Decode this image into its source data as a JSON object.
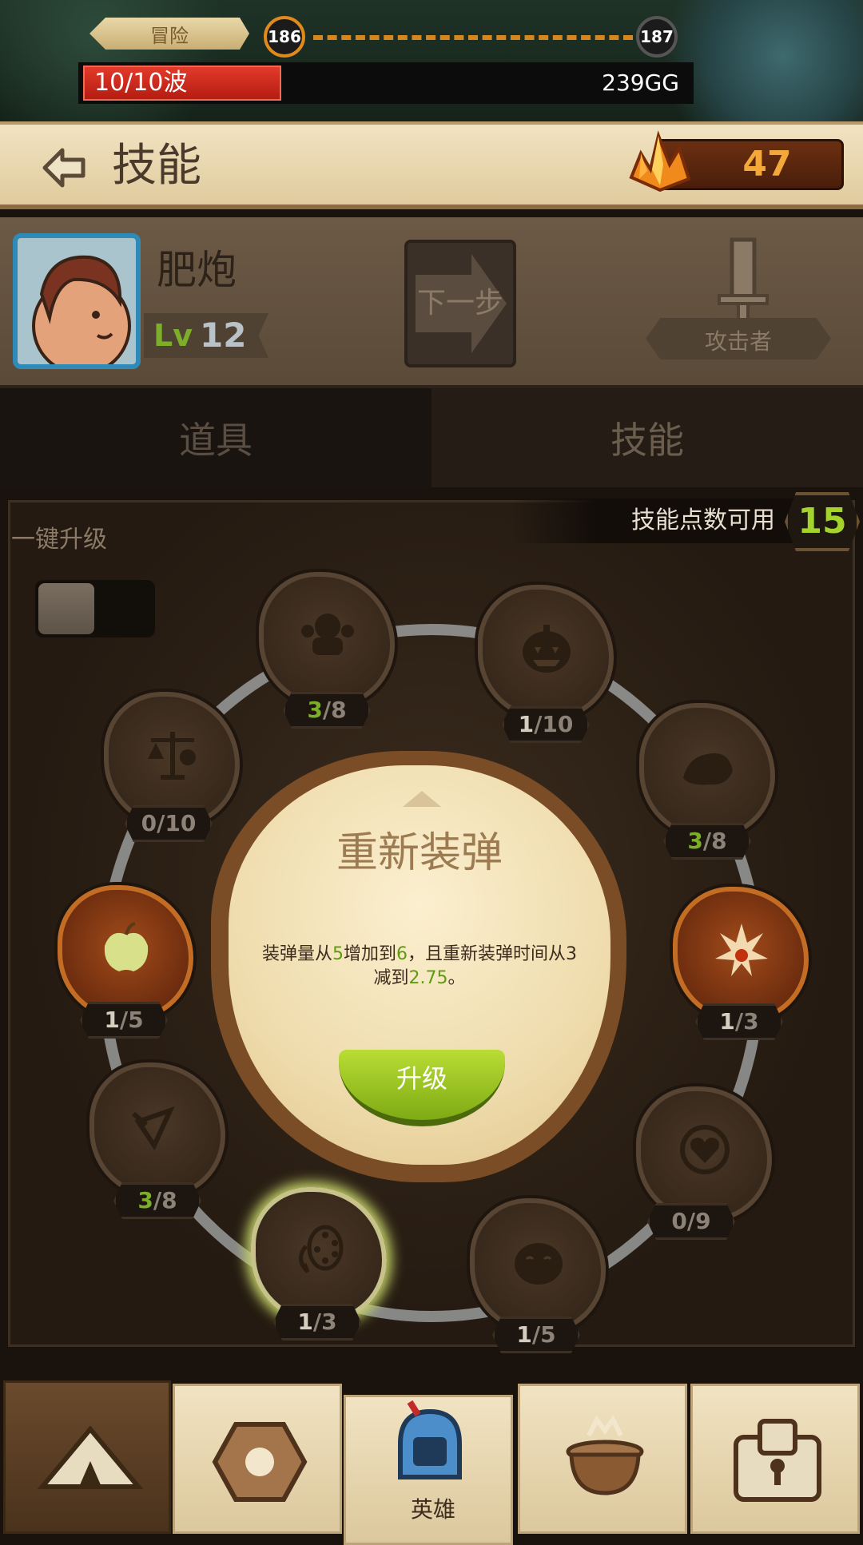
{
  "header": {
    "mode_label": "冒险",
    "current_wave_node": "186",
    "next_wave_node": "187",
    "wave_progress": "10/10波",
    "gold": "239GG"
  },
  "titlebar": {
    "back_icon": "back-arrow-icon",
    "title": "技能",
    "gem_icon": "crystal-icon",
    "gem_count": "47"
  },
  "hero": {
    "name": "肥炮",
    "level_prefix": "Lv",
    "level": "12",
    "next_label": "下一步",
    "role_icon": "sword-icon",
    "role": "攻击者"
  },
  "tabs": [
    {
      "label": "道具",
      "active": false
    },
    {
      "label": "技能",
      "active": true
    }
  ],
  "skills_panel": {
    "points_label": "技能点数可用",
    "points_value": "15",
    "one_click_label": "一键升级",
    "one_click_on": false
  },
  "skills": [
    {
      "icon": "strongman-icon",
      "cur": "3",
      "max": "/8",
      "lit": false,
      "cur_color": "green"
    },
    {
      "icon": "pumpkin-icon",
      "cur": "1",
      "max": "/10",
      "lit": false,
      "cur_color": "white"
    },
    {
      "icon": "island-icon",
      "cur": "3",
      "max": "/8",
      "lit": false,
      "cur_color": "green"
    },
    {
      "icon": "explosion-icon",
      "cur": "1",
      "max": "/3",
      "lit": true,
      "cur_color": "white"
    },
    {
      "icon": "heart-target-icon",
      "cur": "0",
      "max": "/9",
      "lit": false,
      "cur_color": "grey"
    },
    {
      "icon": "face-icon",
      "cur": "1",
      "max": "/5",
      "lit": false,
      "cur_color": "white"
    },
    {
      "icon": "reload-ammo-icon",
      "cur": "1",
      "max": "/3",
      "lit": false,
      "cur_color": "white",
      "selected": true
    },
    {
      "icon": "arrow-hit-icon",
      "cur": "3",
      "max": "/8",
      "lit": false,
      "cur_color": "green"
    },
    {
      "icon": "apple-icon",
      "cur": "1",
      "max": "/5",
      "lit": true,
      "cur_color": "white"
    },
    {
      "icon": "scales-icon",
      "cur": "0",
      "max": "/10",
      "lit": false,
      "cur_color": "grey"
    }
  ],
  "popup": {
    "title": "重新装弹",
    "desc_1": "装弹量从",
    "desc_2": "5",
    "desc_3": "增加到",
    "desc_4": "6",
    "desc_5": "，且重新装弹时间从",
    "desc_6": "3",
    "desc_7": "减到",
    "desc_8": "2.75",
    "desc_9": "。",
    "upgrade_label": "升级"
  },
  "nav": [
    {
      "icon": "camp-tent-icon",
      "label": ""
    },
    {
      "icon": "rune-stone-icon",
      "label": ""
    },
    {
      "icon": "knight-helmet-icon",
      "label": "英雄"
    },
    {
      "icon": "cauldron-icon",
      "label": ""
    },
    {
      "icon": "treasure-chest-icon",
      "label": ""
    }
  ],
  "colors": {
    "accent_green": "#a4d42c",
    "gem_orange": "#f2a93a",
    "wave_red": "#d42a1c"
  }
}
